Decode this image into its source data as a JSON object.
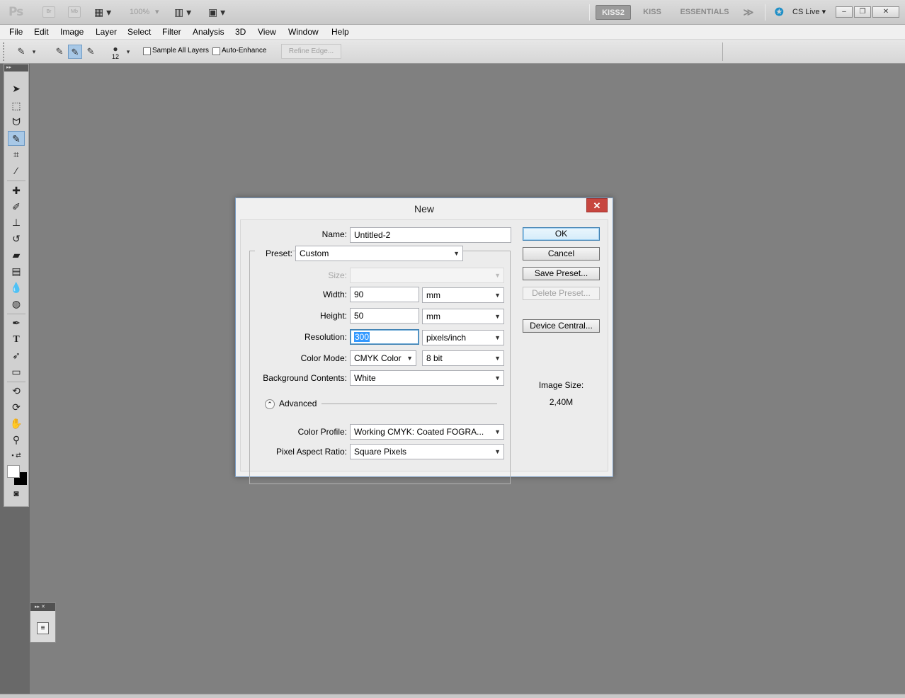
{
  "appbar": {
    "logo": "Ps",
    "bridge": "Br",
    "minibridge": "Mb",
    "zoom": "100%",
    "workspaces": [
      "KISS2",
      "KISS",
      "ESSENTIALS"
    ],
    "more": "≫",
    "cs_live": "CS Live"
  },
  "menu": [
    "File",
    "Edit",
    "Image",
    "Layer",
    "Select",
    "Filter",
    "Analysis",
    "3D",
    "View",
    "Window",
    "Help"
  ],
  "options": {
    "brush_size": "12",
    "sample_all_layers": "Sample All Layers",
    "auto_enhance": "Auto-Enhance",
    "refine_edge": "Refine Edge..."
  },
  "dialog": {
    "title": "New",
    "close": "✕",
    "name_label": "Name:",
    "name_value": "Untitled-2",
    "preset_label": "Preset:",
    "preset_value": "Custom",
    "size_label": "Size:",
    "width_label": "Width:",
    "width_value": "90",
    "width_unit": "mm",
    "height_label": "Height:",
    "height_value": "50",
    "height_unit": "mm",
    "resolution_label": "Resolution:",
    "resolution_value": "300",
    "resolution_unit": "pixels/inch",
    "color_mode_label": "Color Mode:",
    "color_mode_value": "CMYK Color",
    "bit_depth": "8 bit",
    "background_label": "Background Contents:",
    "background_value": "White",
    "advanced_label": "Advanced",
    "color_profile_label": "Color Profile:",
    "color_profile_value": "Working CMYK:  Coated FOGRA...",
    "pixel_aspect_label": "Pixel Aspect Ratio:",
    "pixel_aspect_value": "Square Pixels",
    "buttons": {
      "ok": "OK",
      "cancel": "Cancel",
      "save_preset": "Save Preset...",
      "delete_preset": "Delete Preset...",
      "device_central": "Device Central..."
    },
    "image_size_label": "Image Size:",
    "image_size_value": "2,40M"
  },
  "colors": {
    "canvas_bg": "#808080",
    "accent": "#3399ff",
    "close_red": "#c7463f"
  }
}
